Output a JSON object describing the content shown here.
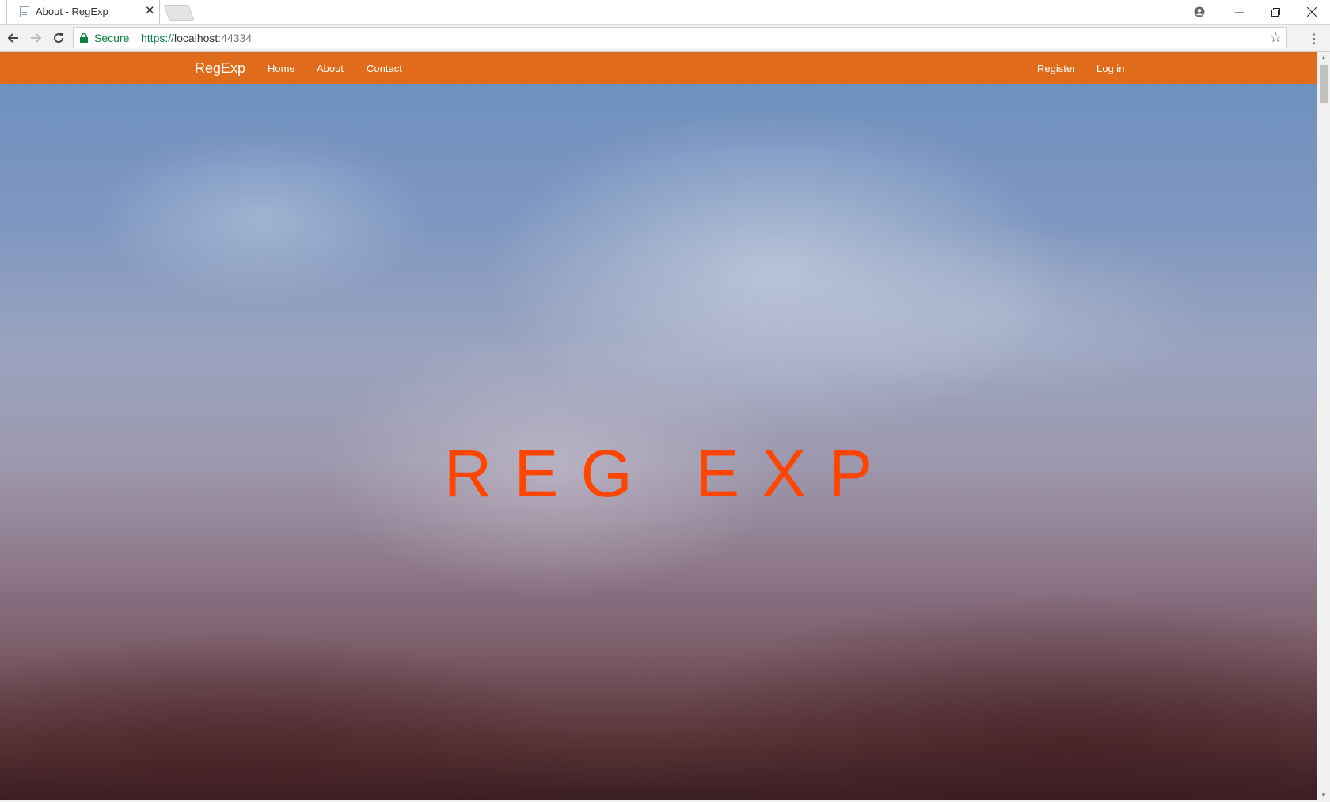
{
  "browser": {
    "tab_title": "About - RegExp",
    "tab_close": "✕",
    "secure_label": "Secure",
    "url_scheme": "https://",
    "url_host": "localhost",
    "url_port": ":44334",
    "window_controls": [
      "minimize",
      "restore",
      "close"
    ]
  },
  "site": {
    "brand": "RegExp",
    "nav_left": [
      "Home",
      "About",
      "Contact"
    ],
    "nav_right": [
      "Register",
      "Log in"
    ],
    "hero_title": "REG EXP",
    "colors": {
      "navbar": "#e06b1b",
      "hero_title": "#ff4500",
      "secure": "#0b8043"
    }
  }
}
